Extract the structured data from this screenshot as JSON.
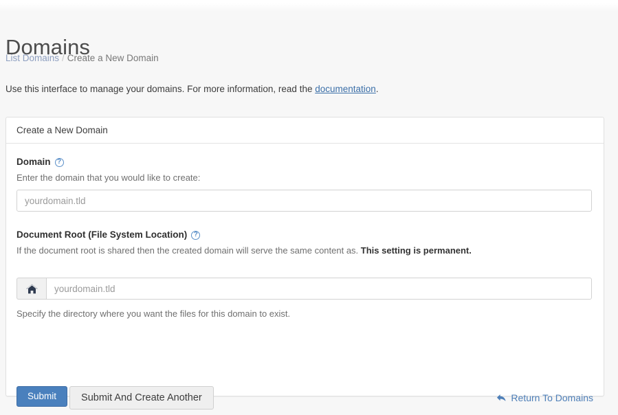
{
  "header": {
    "title": "Domains",
    "breadcrumb": {
      "parent": "List Domains",
      "separator": "/",
      "current": "Create a New Domain"
    },
    "intro_before": "Use this interface to manage your domains. For more information, read the ",
    "intro_link": "documentation",
    "intro_after": "."
  },
  "panel": {
    "title": "Create a New Domain",
    "domain_field": {
      "label": "Domain",
      "help_icon": "question-circle-icon",
      "help_glyph": "?",
      "description": "Enter the domain that you would like to create:",
      "placeholder": "yourdomain.tld",
      "value": ""
    },
    "docroot_field": {
      "label": "Document Root (File System Location)",
      "help_icon": "question-circle-icon",
      "help_glyph": "?",
      "description_normal": "If the document root is shared then the created domain will serve the same content as. ",
      "description_strong": "This setting is permanent.",
      "addon_icon": "home-icon",
      "placeholder": "yourdomain.tld",
      "value": "",
      "helper": "Specify the directory where you want the files for this domain to exist."
    },
    "actions": {
      "submit_label": "Submit",
      "submit_another_label": "Submit And Create Another",
      "return_label": "Return To Domains",
      "return_icon": "back-arrow-icon"
    }
  },
  "colors": {
    "primary": "#4a80bd",
    "link": "#4e7fb8",
    "breadcrumb_link": "#8e9fc0",
    "help_icon": "#5a8fc8",
    "page_bg": "#f7f7f7",
    "panel_bg": "#ffffff",
    "panel_border": "#e0e0e0"
  }
}
